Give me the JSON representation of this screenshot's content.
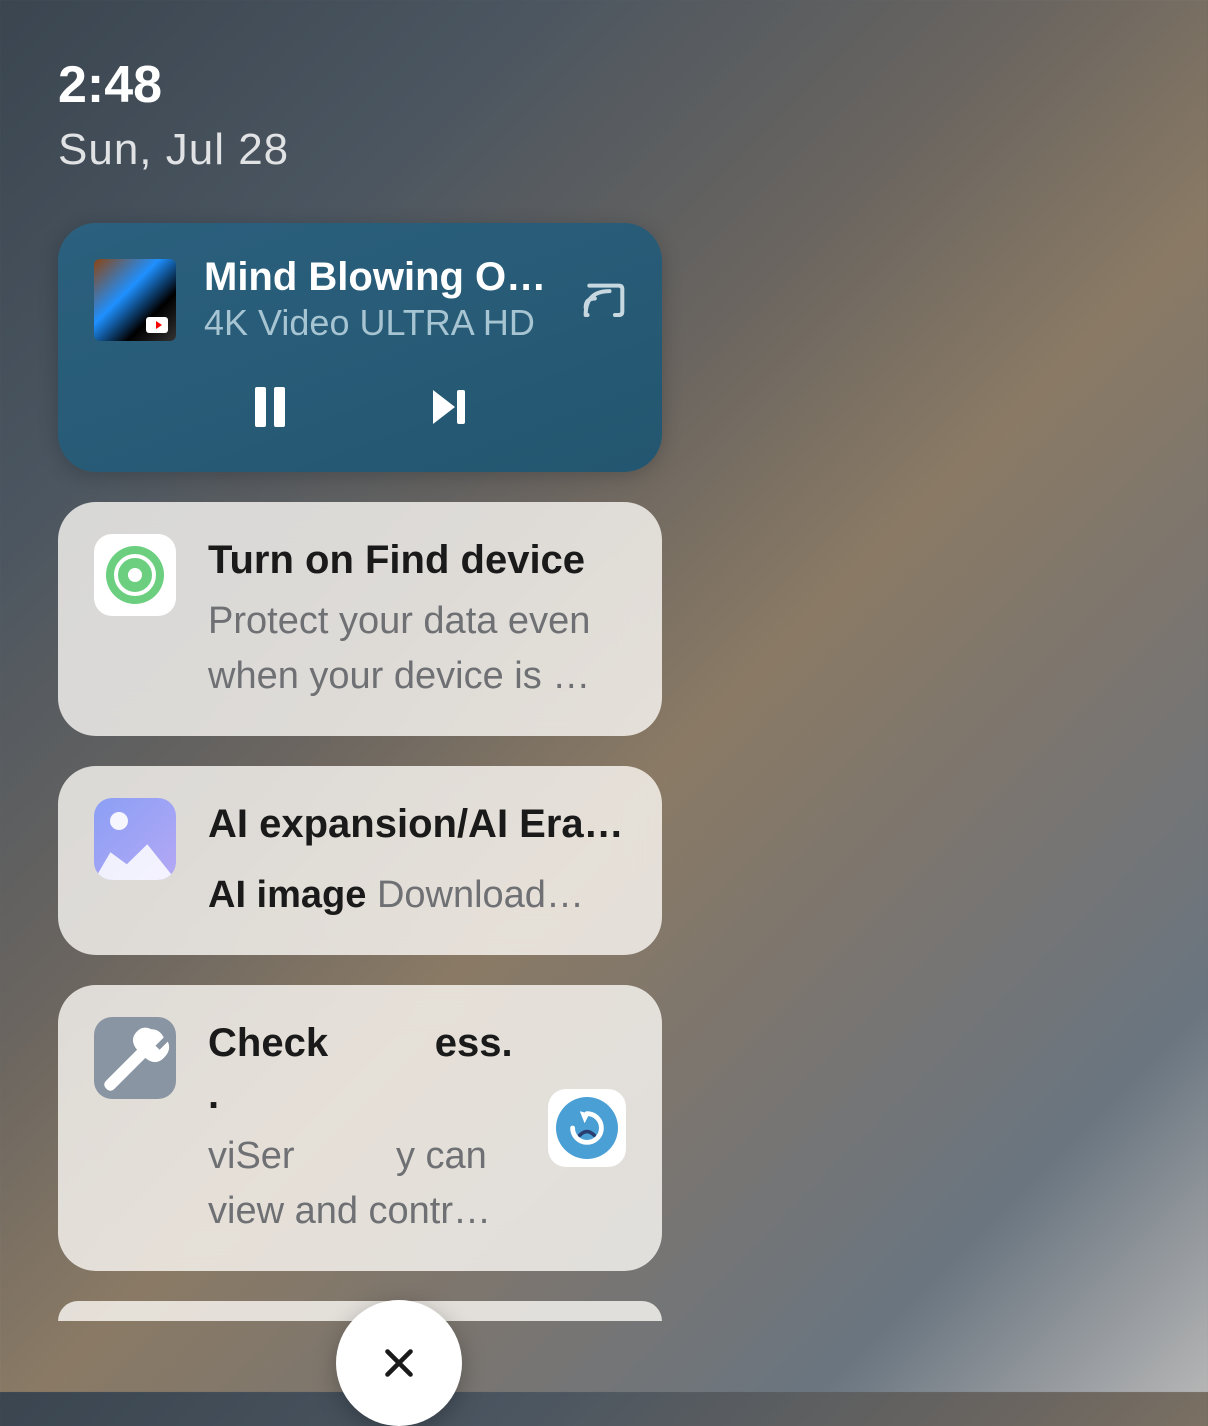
{
  "status": {
    "time": "2:48",
    "date": "Sun, Jul 28"
  },
  "media": {
    "title": "Mind Blowing O…",
    "subtitle": "4K Video ULTRA HD"
  },
  "notifications": [
    {
      "title": "Turn on Find device",
      "body": "Protect your data even when your device is …"
    },
    {
      "title": "AI expansion/AI Era…",
      "body_prefix": "AI image",
      "body": " Download…"
    },
    {
      "title_pre": "Check",
      "title_post": "ess. .",
      "body_pre": "viSer",
      "body_mid": "y can",
      "body_post": "view and contr…"
    }
  ]
}
